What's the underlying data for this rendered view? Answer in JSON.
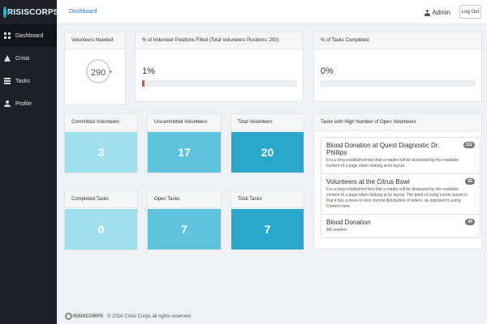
{
  "brand": {
    "logo_text": "RISISCORPS"
  },
  "sidebar": {
    "items": [
      {
        "label": "Dashboard",
        "icon": "grid-icon"
      },
      {
        "label": "Crisis",
        "icon": "alert-icon"
      },
      {
        "label": "Tasks",
        "icon": "list-icon"
      },
      {
        "label": "Profile",
        "icon": "user-icon"
      }
    ]
  },
  "topbar": {
    "breadcrumb": "Dashboard",
    "user_name": "Admin",
    "logout_label": "Log Out"
  },
  "volunteers_needed": {
    "title": "Volunteers Needed",
    "value": "290"
  },
  "positions_filled": {
    "title": "% of Volunteer Positions Filled (Total Volunteers Positions: 293)",
    "value_text": "1%",
    "fraction": 0.01
  },
  "tasks_completed_pct": {
    "title": "% of Tasks Completed",
    "value_text": "0%",
    "fraction": 0
  },
  "volunteer_stats": [
    {
      "label": "Committed Volunteers",
      "value": "3",
      "color": "#9fdfee"
    },
    {
      "label": "Uncommitted Volunteers",
      "value": "17",
      "color": "#5fc3dd"
    },
    {
      "label": "Total Volunteers",
      "value": "20",
      "color": "#2aa8cc"
    }
  ],
  "task_stats": [
    {
      "label": "Completed Tasks",
      "value": "0",
      "color": "#9fdfee"
    },
    {
      "label": "Open Tasks",
      "value": "7",
      "color": "#5fc3dd"
    },
    {
      "label": "Total Tasks",
      "value": "7",
      "color": "#2aa8cc"
    }
  ],
  "open_tasks": {
    "title": "Tasks with High Number of Open Volunteers",
    "items": [
      {
        "title": "Blood Donation at Quest Diagnostic Dr. Phillips",
        "badge": "122",
        "description": "It is a long established fact that a reader will be distracted by the readable content of a page when looking at its layout."
      },
      {
        "title": "Volunteers at the Citrus Bowl",
        "badge": "65",
        "description": "It is a long established fact that a reader will be distracted by the readable content of a page when looking at its layout. The point of using Lorem Ipsum is that it has a more-or-less normal distribution of letters, as opposed to using Content here."
      },
      {
        "title": "Blood Donation",
        "badge": "40",
        "description": "AB needed"
      }
    ]
  },
  "footer": {
    "logo_text": "RISISCORPS",
    "copyright": "© 2016 Crisis Corps all rights reserved"
  }
}
